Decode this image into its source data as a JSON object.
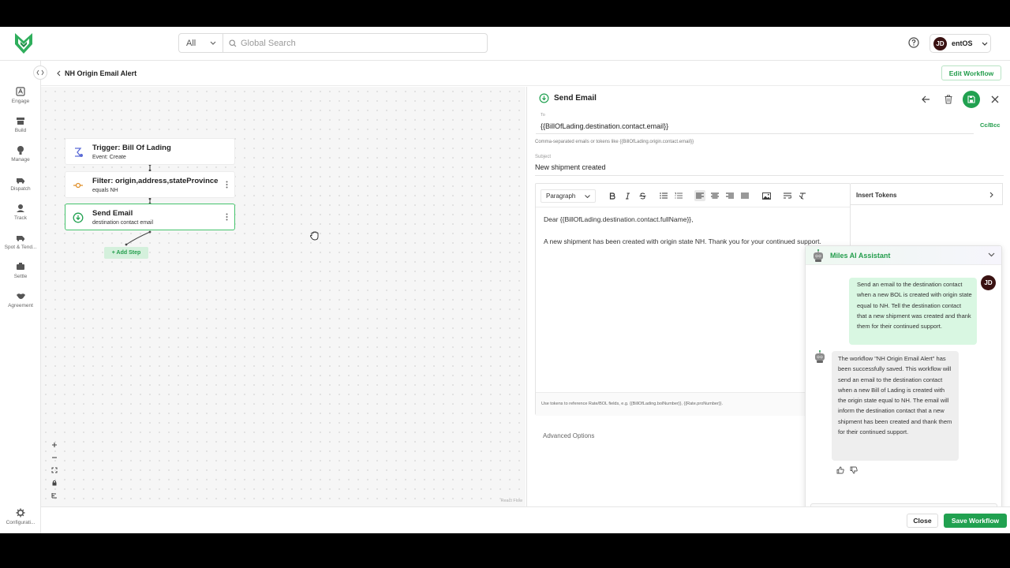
{
  "header": {
    "scope_select": "All",
    "search_placeholder": "Global Search",
    "user_initials": "JD",
    "user_name": "entOS"
  },
  "nav": {
    "items": [
      {
        "label": "Engage",
        "icon": "engage-icon"
      },
      {
        "label": "Build",
        "icon": "build-icon"
      },
      {
        "label": "Manage",
        "icon": "manage-icon"
      },
      {
        "label": "Dispatch",
        "icon": "dispatch-icon"
      },
      {
        "label": "Track",
        "icon": "track-icon"
      },
      {
        "label": "Spot & Tend...",
        "icon": "spot-tender-icon"
      },
      {
        "label": "Settle",
        "icon": "settle-icon"
      },
      {
        "label": "Agreement",
        "icon": "agreement-icon"
      }
    ],
    "configuration": "Configurati..."
  },
  "subheader": {
    "breadcrumb": "NH Origin Email Alert",
    "edit_workflow": "Edit Workflow"
  },
  "canvas": {
    "nodes": [
      {
        "title": "Trigger: Bill Of Lading",
        "subtitle": "Event: Create"
      },
      {
        "title": "Filter: origin,address,stateProvince",
        "subtitle": "equals NH"
      },
      {
        "title": "Send Email",
        "subtitle": "destination contact email"
      }
    ],
    "add_step": "+ Add Step",
    "attribution": "React Flow"
  },
  "panel": {
    "title": "Send Email",
    "to_label": "To",
    "to_value": "{{BillOfLading.destination.contact.email}}",
    "cc_bcc": "Cc/Bcc",
    "to_hint": "Comma-separated emails or tokens like {{BillOfLading.origin.contact.email}}",
    "subject_label": "Subject",
    "subject_value": "New shipment created",
    "format_select": "Paragraph",
    "body_line1": "Dear {{BillOfLading.destination.contact.fullName}},",
    "body_line2": "A new shipment has been created with origin state NH. Thank you for your continued support.",
    "editor_hint": "Use tokens to reference Rate/BOL fields, e.g. {{BillOfLading.bolNumber}}, {{Rate.proNumber}}.",
    "insert_tokens": "Insert Tokens",
    "advanced_options": "Advanced Options"
  },
  "assistant": {
    "title": "Miles AI Assistant",
    "user_initials": "JD",
    "user_message": "Send an email to the destination contact when a new BOL is created with origin state equal to NH. Tell the destination contact that a new shipment was created and thank them for their continued support.",
    "bot_message": "The workflow \"NH Origin Email Alert\" has been successfully saved. This workflow will send an email to the destination contact when a new Bill of Lading is created with the origin state equal to NH. The email will inform the destination contact that a new shipment has been created and thank them for their continued support.",
    "input_placeholder": ""
  },
  "footer": {
    "close": "Close",
    "save_workflow": "Save Workflow"
  },
  "colors": {
    "brand_green": "#21a150",
    "light_green": "#d9f7e2"
  }
}
